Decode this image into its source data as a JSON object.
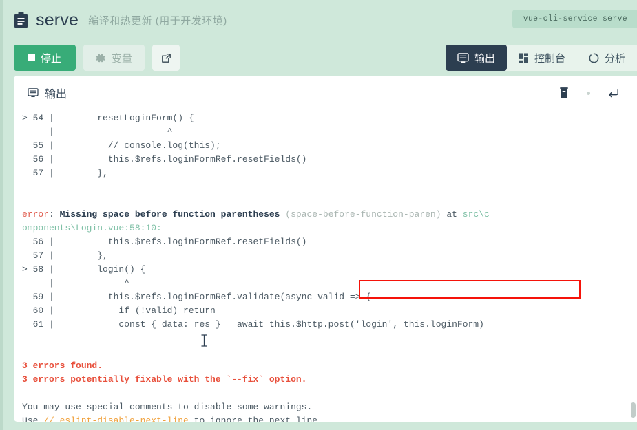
{
  "header": {
    "icon": "clipboard-icon",
    "title": "serve",
    "subtitle": "编译和热更新 (用于开发环境)",
    "command_chip": "vue-cli-service serve"
  },
  "toolbar": {
    "stop_label": "停止",
    "variables_label": "变量",
    "open_external_label": "",
    "tabs": [
      {
        "label": "输出",
        "icon": "monitor-icon",
        "active": true
      },
      {
        "label": "控制台",
        "icon": "dashboard-icon",
        "active": false
      },
      {
        "label": "分析",
        "icon": "analyze-icon",
        "active": false
      }
    ]
  },
  "output_panel": {
    "title": "输出",
    "title_icon": "monitor-icon",
    "actions": [
      {
        "name": "clear-output-icon",
        "glyph": "trash"
      },
      {
        "name": "status-dot-icon",
        "glyph": "dot"
      },
      {
        "name": "wrap-lines-icon",
        "glyph": "return-arrow"
      }
    ]
  },
  "colors": {
    "page_background": "#cfe8da",
    "accent_green": "#38ac78",
    "tab_active_bg": "#2c3e50",
    "annotation_red": "#f5130a",
    "error_red": "#e8503c",
    "path_teal": "#7fc0a6",
    "comment_orange": "#f0a13c"
  },
  "annotation": {
    "name": "rule-name-highlight-box",
    "target_text": "(space-before-function-paren)",
    "color": "#f5130a"
  },
  "log": {
    "lines": [
      {
        "segments": [
          {
            "t": "> 54 |        resetLoginForm() {",
            "c": "plain"
          }
        ]
      },
      {
        "segments": [
          {
            "t": "     |                     ^",
            "c": "plain"
          }
        ]
      },
      {
        "segments": [
          {
            "t": "  55 |          // console.log(this);",
            "c": "plain"
          }
        ]
      },
      {
        "segments": [
          {
            "t": "  56 |          this.$refs.loginFormRef.resetFields()",
            "c": "plain"
          }
        ]
      },
      {
        "segments": [
          {
            "t": "  57 |        },",
            "c": "plain"
          }
        ]
      },
      {
        "segments": [
          {
            "t": "",
            "c": "plain"
          }
        ]
      },
      {
        "segments": [
          {
            "t": "",
            "c": "plain"
          }
        ]
      },
      {
        "segments": [
          {
            "t": "error",
            "c": "red"
          },
          {
            "t": ": ",
            "c": "plain"
          },
          {
            "t": "Missing space before function parentheses",
            "c": "dark-b"
          },
          {
            "t": " (space-before-function-paren)",
            "c": "gray"
          },
          {
            "t": " at ",
            "c": "plain"
          },
          {
            "t": "src\\c",
            "c": "teal"
          }
        ]
      },
      {
        "segments": [
          {
            "t": "omponents\\Login.vue:58:10:",
            "c": "teal"
          }
        ]
      },
      {
        "segments": [
          {
            "t": "  56 |          this.$refs.loginFormRef.resetFields()",
            "c": "plain"
          }
        ]
      },
      {
        "segments": [
          {
            "t": "  57 |        },",
            "c": "plain"
          }
        ]
      },
      {
        "segments": [
          {
            "t": "> 58 |        login() {",
            "c": "plain"
          }
        ]
      },
      {
        "segments": [
          {
            "t": "     |             ^",
            "c": "plain"
          }
        ]
      },
      {
        "segments": [
          {
            "t": "  59 |          this.$refs.loginFormRef.validate(async valid => {",
            "c": "plain"
          }
        ]
      },
      {
        "segments": [
          {
            "t": "  60 |            if (!valid) return",
            "c": "plain"
          }
        ]
      },
      {
        "segments": [
          {
            "t": "  61 |            const { data: res } = await this.$http.post('login', this.loginForm)",
            "c": "plain"
          }
        ]
      },
      {
        "segments": [
          {
            "t": "",
            "c": "plain"
          }
        ]
      },
      {
        "segments": [
          {
            "t": "",
            "c": "plain"
          }
        ]
      },
      {
        "segments": [
          {
            "t": "3 errors found.",
            "c": "red-b"
          }
        ]
      },
      {
        "segments": [
          {
            "t": "3 errors potentially fixable with the `--fix` option.",
            "c": "red-b"
          }
        ]
      },
      {
        "segments": [
          {
            "t": "",
            "c": "plain"
          }
        ]
      },
      {
        "segments": [
          {
            "t": "You may use special comments to disable some warnings.",
            "c": "plain"
          }
        ]
      },
      {
        "segments": [
          {
            "t": "Use ",
            "c": "plain"
          },
          {
            "t": "// eslint-disable-next-line",
            "c": "orange"
          },
          {
            "t": " to ignore the next line.",
            "c": "plain"
          }
        ]
      }
    ]
  }
}
